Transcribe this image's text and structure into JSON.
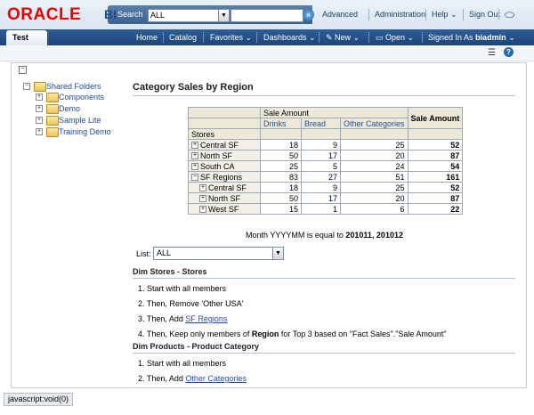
{
  "header": {
    "logo": "ORACLE",
    "bi": "BI",
    "search_label": "Search",
    "search_scope": "ALL",
    "links": [
      "Advanced",
      "Administration",
      "Help",
      "Sign Out"
    ]
  },
  "nav": {
    "tab": "Test",
    "links": [
      "Home",
      "Catalog",
      "Favorites",
      "Dashboards",
      "New",
      "Open",
      "Signed In As"
    ],
    "user": "biadmin"
  },
  "tree": {
    "root": "Shared Folders",
    "children": [
      "Components",
      "Demo",
      "Sample Lite",
      "Training Demo"
    ]
  },
  "report": {
    "title": "Category Sales by Region",
    "measure_header": "Sale Amount",
    "columns": [
      "Drinks",
      "Bread",
      "Other Categories"
    ],
    "total_header": "Sale Amount",
    "row_dim": "Stores",
    "rows": [
      {
        "label": "Central SF",
        "vals": [
          "18",
          "9",
          "25"
        ],
        "total": "52",
        "indent": 0,
        "sym": "+"
      },
      {
        "label": "North SF",
        "vals": [
          "50",
          "17",
          "20"
        ],
        "total": "87",
        "indent": 0,
        "sym": "+"
      },
      {
        "label": "South CA",
        "vals": [
          "25",
          "5",
          "24"
        ],
        "total": "54",
        "indent": 0,
        "sym": "+"
      },
      {
        "label": "SF Regions",
        "vals": [
          "83",
          "27",
          "51"
        ],
        "total": "161",
        "indent": 0,
        "sym": "-"
      },
      {
        "label": "Central SF",
        "vals": [
          "18",
          "9",
          "25"
        ],
        "total": "52",
        "indent": 1,
        "sym": "+"
      },
      {
        "label": "North SF",
        "vals": [
          "50",
          "17",
          "20"
        ],
        "total": "87",
        "indent": 1,
        "sym": "+"
      },
      {
        "label": "West SF",
        "vals": [
          "15",
          "1",
          "6"
        ],
        "total": "22",
        "indent": 1,
        "sym": "+"
      }
    ],
    "filter_prefix": "Month YYYYMM is equal to ",
    "filter_value": "201011, 201012",
    "list_label": "List:",
    "list_value": "ALL"
  },
  "steps1": {
    "heading": "Dim Stores - Stores",
    "s1": "1. Start with all members",
    "s2": "2. Then, Remove 'Other USA'",
    "s3_prefix": "3. Then, Add ",
    "s3_link": "SF Regions",
    "s4_prefix": "4. Then, Keep only members of ",
    "s4_bold": "Region",
    "s4_suffix": " for Top 3 based on \"Fact Sales\".\"Sale Amount\""
  },
  "steps2": {
    "heading": "Dim Products - Product Category",
    "s1": "1. Start with all members",
    "s2_prefix": "2. Then, Add ",
    "s2_link": "Other Categories"
  },
  "status": "javascript:void(0)"
}
